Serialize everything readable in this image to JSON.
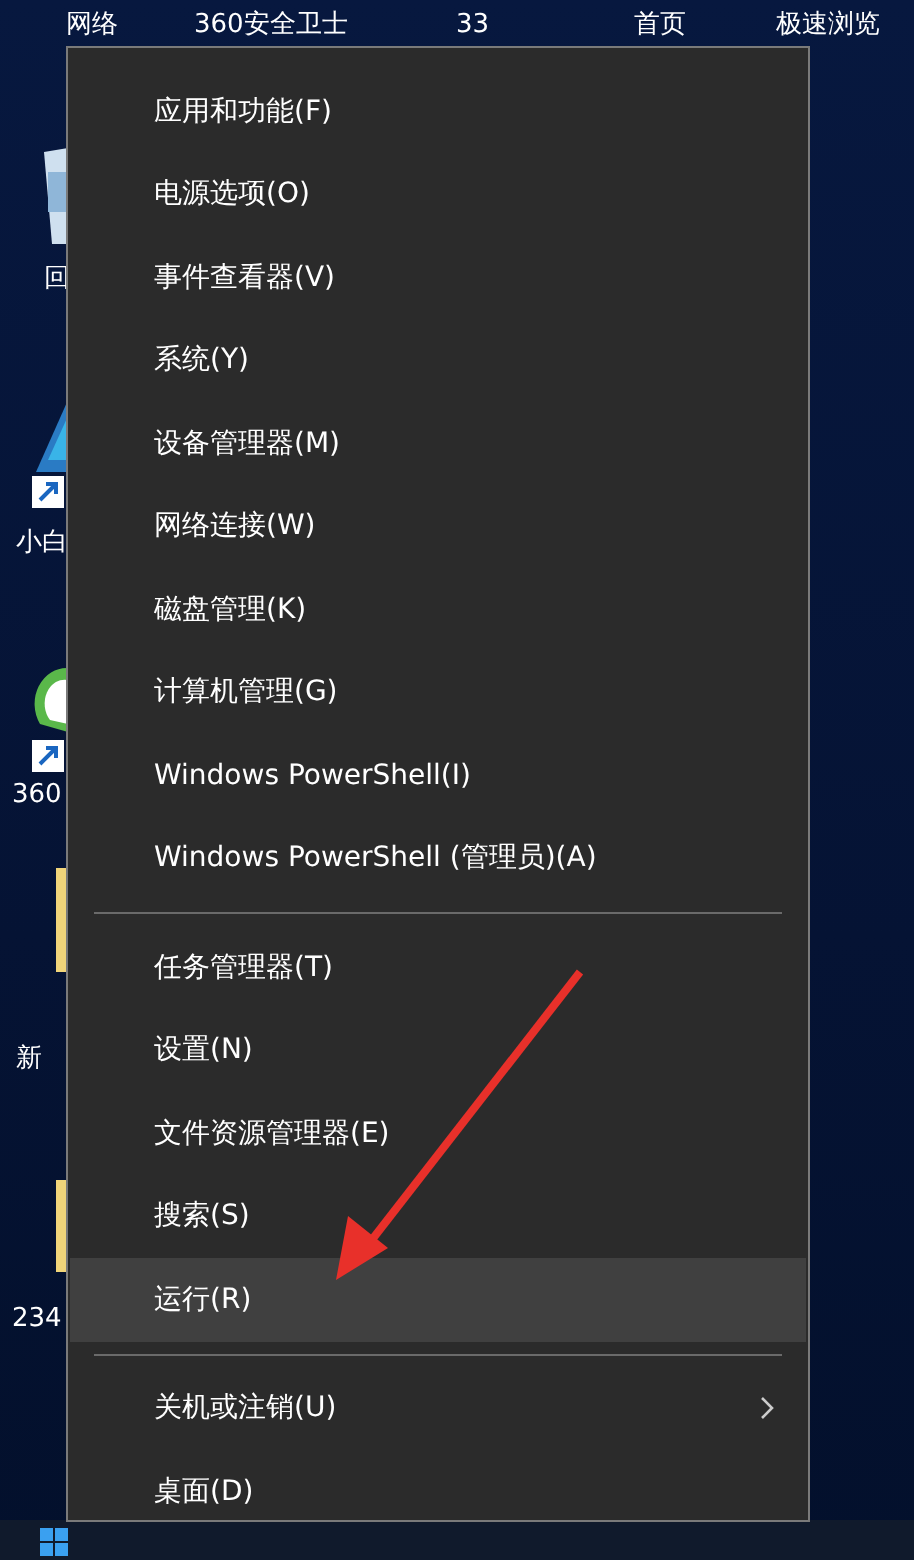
{
  "desktop": {
    "top_labels": [
      "网络",
      "360安全卫士",
      "33",
      "首页",
      "极速浏览"
    ],
    "side_labels": [
      "回",
      "小白",
      "360",
      "新",
      "234"
    ]
  },
  "menu": {
    "groups": [
      [
        {
          "label": "应用和功能(F)",
          "selected": false,
          "submenu": false
        },
        {
          "label": "电源选项(O)",
          "selected": false,
          "submenu": false
        },
        {
          "label": "事件查看器(V)",
          "selected": false,
          "submenu": false
        },
        {
          "label": "系统(Y)",
          "selected": false,
          "submenu": false
        },
        {
          "label": "设备管理器(M)",
          "selected": false,
          "submenu": false
        },
        {
          "label": "网络连接(W)",
          "selected": false,
          "submenu": false
        },
        {
          "label": "磁盘管理(K)",
          "selected": false,
          "submenu": false
        },
        {
          "label": "计算机管理(G)",
          "selected": false,
          "submenu": false
        },
        {
          "label": "Windows PowerShell(I)",
          "selected": false,
          "submenu": false
        },
        {
          "label": "Windows PowerShell (管理员)(A)",
          "selected": false,
          "submenu": false
        }
      ],
      [
        {
          "label": "任务管理器(T)",
          "selected": false,
          "submenu": false
        },
        {
          "label": "设置(N)",
          "selected": false,
          "submenu": false
        },
        {
          "label": "文件资源管理器(E)",
          "selected": false,
          "submenu": false
        },
        {
          "label": "搜索(S)",
          "selected": false,
          "submenu": false
        },
        {
          "label": "运行(R)",
          "selected": true,
          "submenu": false
        }
      ],
      [
        {
          "label": "关机或注销(U)",
          "selected": false,
          "submenu": true
        },
        {
          "label": "桌面(D)",
          "selected": false,
          "submenu": false
        }
      ]
    ]
  }
}
